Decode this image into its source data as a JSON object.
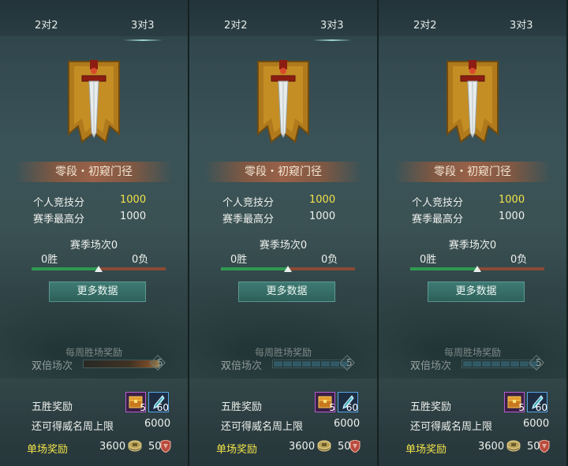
{
  "panels": [
    {
      "tab_left": "2对2",
      "tab_right": "3对3",
      "active_tab": "right",
      "rank_title": "零段・初窥门径",
      "personal_score_label": "个人竞技分",
      "personal_score_value": "1000",
      "season_high_label": "赛季最高分",
      "season_high_value": "1000",
      "season_matches": "赛季场次0",
      "wins": "0胜",
      "losses": "0负",
      "win_ratio": 0.5,
      "more_button": "更多数据",
      "weekly_reward_label": "每周胜场奖励",
      "double_label": "双倍场次",
      "double_count": "5",
      "double_bar_style": "hot",
      "five_win_label": "五胜奖励",
      "item1_count": "5",
      "item2_count": "60",
      "prestige_limit_label": "还可得威名周上限",
      "prestige_limit_value": "6000",
      "single_reward_label": "单场奖励",
      "single_coin_value": "3600",
      "single_honor_value": "50"
    },
    {
      "tab_left": "2对2",
      "tab_right": "3对3",
      "active_tab": "right",
      "rank_title": "零段・初窥门径",
      "personal_score_label": "个人竞技分",
      "personal_score_value": "1000",
      "season_high_label": "赛季最高分",
      "season_high_value": "1000",
      "season_matches": "赛季场次0",
      "wins": "0胜",
      "losses": "0负",
      "win_ratio": 0.5,
      "more_button": "更多数据",
      "weekly_reward_label": "每周胜场奖励",
      "double_label": "双倍场次",
      "double_count": "5",
      "double_bar_style": "segmented",
      "five_win_label": "五胜奖励",
      "item1_count": "5",
      "item2_count": "60",
      "prestige_limit_label": "还可得威名周上限",
      "prestige_limit_value": "6000",
      "single_reward_label": "单场奖励",
      "single_coin_value": "3600",
      "single_honor_value": "50"
    },
    {
      "tab_left": "2对2",
      "tab_right": "3对3",
      "active_tab": "none",
      "rank_title": "零段・初窥门径",
      "personal_score_label": "个人竞技分",
      "personal_score_value": "1000",
      "season_high_label": "赛季最高分",
      "season_high_value": "1000",
      "season_matches": "赛季场次0",
      "wins": "0胜",
      "losses": "0负",
      "win_ratio": 0.5,
      "more_button": "更多数据",
      "weekly_reward_label": "每周胜场奖励",
      "double_label": "双倍场次",
      "double_count": "5",
      "double_bar_style": "segmented",
      "five_win_label": "五胜奖励",
      "item1_count": "5",
      "item2_count": "60",
      "prestige_limit_label": "还可得威名周上限",
      "prestige_limit_value": "6000",
      "single_reward_label": "单场奖励",
      "single_coin_value": "3600",
      "single_honor_value": "50"
    }
  ],
  "colors": {
    "highlight_yellow": "#f1e24a",
    "win_green": "#2e9a52",
    "loss_red": "#8a4a35",
    "button_teal": "#3e7a73"
  },
  "icons": {
    "emblem": "banner-sword-icon",
    "item1": "treasure-chest-icon",
    "item2": "feather-token-icon",
    "coin": "coin-icon",
    "honor": "shield-icon"
  }
}
